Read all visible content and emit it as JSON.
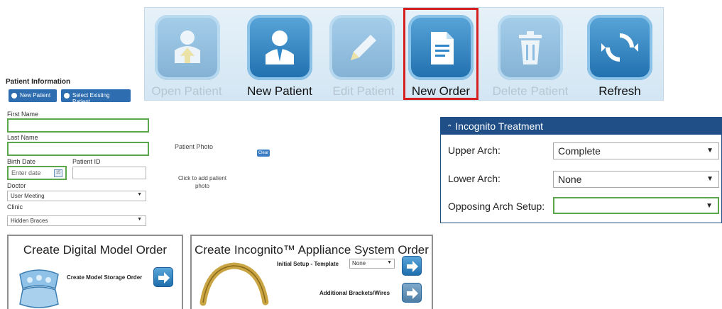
{
  "toolbar": {
    "buttons": [
      {
        "label": "Open Patient",
        "icon": "open-patient-icon",
        "enabled": false
      },
      {
        "label": "New Patient",
        "icon": "new-patient-icon",
        "enabled": true
      },
      {
        "label": "Edit Patient",
        "icon": "edit-patient-icon",
        "enabled": false
      },
      {
        "label": "New Order",
        "icon": "new-order-icon",
        "enabled": true,
        "highlighted": true
      },
      {
        "label": "Delete Patient",
        "icon": "delete-patient-icon",
        "enabled": false
      },
      {
        "label": "Refresh",
        "icon": "refresh-icon",
        "enabled": true
      }
    ]
  },
  "patient_info": {
    "title": "Patient Information",
    "new_patient_option": "New Patient",
    "select_existing_option": "Select Existing Patient",
    "first_name_label": "First Name",
    "first_name_value": "",
    "last_name_label": "Last Name",
    "last_name_value": "",
    "birth_date_label": "Birth Date",
    "birth_date_placeholder": "Enter date",
    "calendar_day": "15",
    "patient_id_label": "Patient ID",
    "patient_id_value": "",
    "doctor_label": "Doctor",
    "doctor_value": "User Meeting",
    "clinic_label": "Clinic",
    "clinic_value": "Hidden Braces"
  },
  "patient_photo": {
    "label": "Patient Photo",
    "badge": "Clear",
    "click_text": "Click to add patient photo"
  },
  "digital_model_order": {
    "title": "Create Digital Model Order",
    "action_label": "Create Model Storage Order"
  },
  "appliance_order": {
    "title": "Create Incognito™ Appliance System Order",
    "initial_setup_label": "Initial Setup - Template",
    "template_value": "None",
    "additional_label": "Additional Brackets/Wires"
  },
  "incognito_treatment": {
    "header": "Incognito Treatment",
    "upper_arch_label": "Upper Arch:",
    "upper_arch_value": "Complete",
    "lower_arch_label": "Lower Arch:",
    "lower_arch_value": "None",
    "opposing_label": "Opposing Arch Setup:",
    "opposing_value": ""
  },
  "colors": {
    "toolbar_bg": "#dcebf6",
    "button_blue": "#2f86c8",
    "highlight_red": "#d62020",
    "highlight_green": "#5aa64a",
    "header_blue": "#1f4f86"
  }
}
